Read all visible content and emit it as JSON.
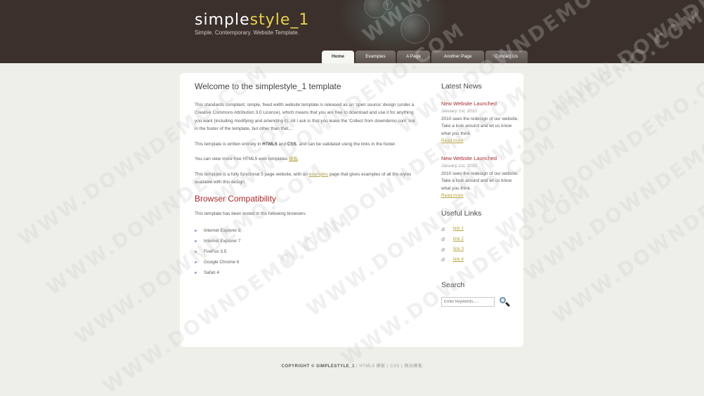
{
  "header": {
    "logo_part1": "simple",
    "logo_part2": "style_1",
    "slogan": "Simple. Contemporary. Website Template."
  },
  "nav": {
    "tabs": [
      {
        "label": "Home",
        "active": true
      },
      {
        "label": "Examples",
        "active": false
      },
      {
        "label": "A Page",
        "active": false
      },
      {
        "label": "Another Page",
        "active": false
      },
      {
        "label": "Contact Us",
        "active": false
      }
    ]
  },
  "main": {
    "title": "Welcome to the simplestyle_1 template",
    "p1": "This standards compliant, simple, fixed width website template is released as an 'open source' design (under a Creative Commons Attribution 3.0 Licence), which means that you are free to download and use it for anything you want (including modifying and amending it). All I ask is that you leave the 'Collect from downdemo.com' link in the footer of the template, but other than that....",
    "p2_pre": "This template is written entirely in ",
    "p2_html5": "HTML5",
    "p2_and": " and ",
    "p2_css": "CSS",
    "p2_post": ", and can be validated using the links in the footer.",
    "p3_pre": "You can view more free HTML5 web templates ",
    "p3_link": "模板",
    "p3_post": ".",
    "p4_pre": "This template is a fully functional 5 page website, with an ",
    "p4_link": "examples",
    "p4_post": " page that gives examples of all the styles available with this design.",
    "compat_title": "Browser Compatibility",
    "compat_intro": "This template has been tested in the following browsers:",
    "browsers": [
      "Internet Explorer 8",
      "Internet Explorer 7",
      "FireFox 3.5",
      "Google Chrome 6",
      "Safari 4"
    ]
  },
  "sidebar": {
    "news_title": "Latest News",
    "news": [
      {
        "headline": "New Website Launched",
        "date": "January 1st, 2010",
        "body": "2010 sees the redesign of our website. Take a look around and let us know what you think.",
        "more": "Read more"
      },
      {
        "headline": "New Website Launched",
        "date": "January 1st, 2010",
        "body": "2010 sees the redesign of our website. Take a look around and let us know what you think.",
        "more": "Read more"
      }
    ],
    "links_title": "Useful Links",
    "links": [
      "link 1",
      "link 2",
      "link 3",
      "link 4"
    ],
    "search_title": "Search",
    "search_placeholder": "Enter keywords....."
  },
  "footer": {
    "copyright": "COPYRIGHT © SIMPLESTYLE_1",
    "sep": " | ",
    "html5": "HTML5 模板",
    "css": "CSS",
    "tpl": "网站模板"
  },
  "watermark": "WWW.DOWNDEMO.COM",
  "colors": {
    "header_bg": "#3b302c",
    "logo_accent": "#e8d24a",
    "heading_red": "#a8282a",
    "link": "#b5a33a",
    "page_bg": "#efefea"
  }
}
